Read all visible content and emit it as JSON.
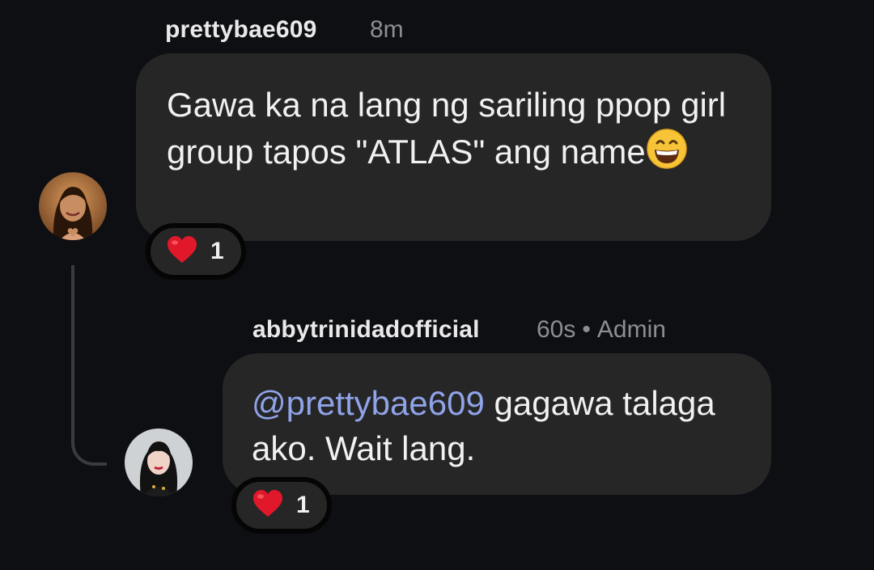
{
  "comments": [
    {
      "username": "prettybae609",
      "time": "8m",
      "text": "Gawa ka na lang ng sariling ppop girl group tapos \"ATLAS\" ang name",
      "reaction_count": "1"
    },
    {
      "username": "abbytrinidadofficial",
      "time": "60s",
      "separator": "•",
      "badge": "Admin",
      "mention": "@prettybae609",
      "text": " gagawa talaga ako. Wait lang.",
      "reaction_count": "1"
    }
  ],
  "colors": {
    "background": "#0e0f13",
    "bubble": "#262626",
    "mention": "#8fa3e8",
    "meta": "#8c8e94",
    "heart": "#e0182a"
  },
  "icons": {
    "inline_emoji": "grinning-face-emoji",
    "reaction": "red-heart-icon"
  }
}
